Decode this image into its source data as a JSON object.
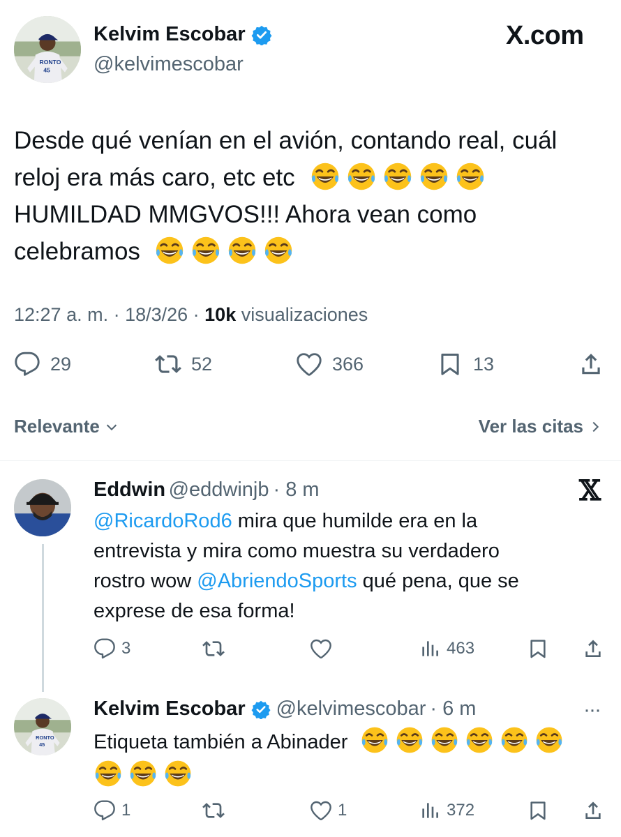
{
  "post": {
    "author_name": "Kelvim Escobar",
    "author_handle": "@kelvimescobar",
    "brand": "X.com",
    "text_line1": "Desde qué venían en el avión, contando real, cuál",
    "text_line2": "reloj era más caro, etc etc",
    "text_line3": "HUMILDAD MMGVOS!!! Ahora vean como",
    "text_line4": "celebramos",
    "time": "12:27 a. m. · 18/3/26 · ",
    "views_count": "10k",
    "views_label": " visualizaciones",
    "replies": "29",
    "reposts": "52",
    "likes": "366",
    "bookmarks": "13"
  },
  "sort": {
    "label": "Relevante",
    "quotes_link": "Ver las citas"
  },
  "reply1": {
    "author_name": "Eddwin",
    "author_handle": "@eddwinjb",
    "age": "· 8 m",
    "mention1": "@RicardoRod6",
    "text_a": " mira que humilde era en la",
    "text_b": "entrevista y mira como muestra su verdadero",
    "text_c": "rostro wow ",
    "mention2": "@AbriendoSports",
    "text_d": " qué pena, que se",
    "text_e": "exprese de esa forma!",
    "replies": "3",
    "reposts": "",
    "likes": "",
    "views": "463"
  },
  "reply2": {
    "author_name": "Kelvim Escobar",
    "author_handle": "@kelvimescobar",
    "age": "· 6 m",
    "text": "Etiqueta también a Abinader",
    "replies": "1",
    "reposts": "",
    "likes": "1",
    "views": "372"
  },
  "colors": {
    "accent": "#1d9bf0",
    "text": "#0f1419",
    "muted": "#536471"
  }
}
